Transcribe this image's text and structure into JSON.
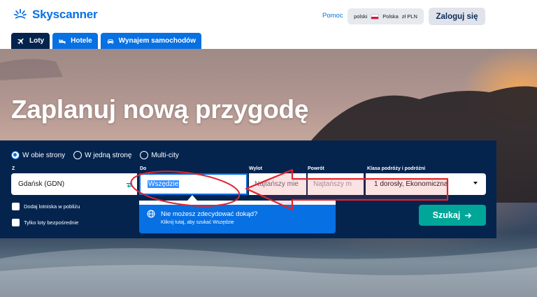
{
  "brand": {
    "name": "Skyscanner",
    "color": "#0770e3"
  },
  "header": {
    "help_label": "Pomoc",
    "locale": {
      "language": "polski",
      "country": "Polska",
      "currency": "zł PLN"
    },
    "login_label": "Zaloguj się"
  },
  "tabs": [
    {
      "label": "Loty",
      "icon": "plane-icon",
      "active": true
    },
    {
      "label": "Hotele",
      "icon": "bed-icon",
      "active": false
    },
    {
      "label": "Wynajem samochodów",
      "icon": "car-icon",
      "active": false
    }
  ],
  "hero": {
    "title": "Zaplanuj nową przygodę"
  },
  "search": {
    "trip_types": [
      {
        "label": "W obie strony",
        "selected": true
      },
      {
        "label": "W jedną stronę",
        "selected": false
      },
      {
        "label": "Multi-city",
        "selected": false
      }
    ],
    "labels": {
      "from": "Z",
      "to": "Do",
      "depart": "Wylot",
      "return": "Powrót",
      "class": "Klasa podróży i podróżni"
    },
    "from_value": "Gdańsk (GDN)",
    "to_value": "Wszędzie",
    "depart_value": "Najtańszy mie",
    "return_value": "Najtańszy m",
    "class_value": "1 dorosły, Ekonomiczna",
    "checkboxes": [
      {
        "label": "Dodaj lotniska w pobliżu",
        "checked": false
      },
      {
        "label": "Tylko loty bezpośrednie",
        "checked": false
      }
    ],
    "submit_label": "Szukaj"
  },
  "tooltip": {
    "title": "Nie możesz zdecydować dokąd?",
    "subtitle": "Kliknij tutaj, aby szukać Wszędzie"
  },
  "colors": {
    "panel": "#04244e",
    "accent": "#0770e3",
    "search_button": "#00a698",
    "annotation": "#e0242f"
  }
}
